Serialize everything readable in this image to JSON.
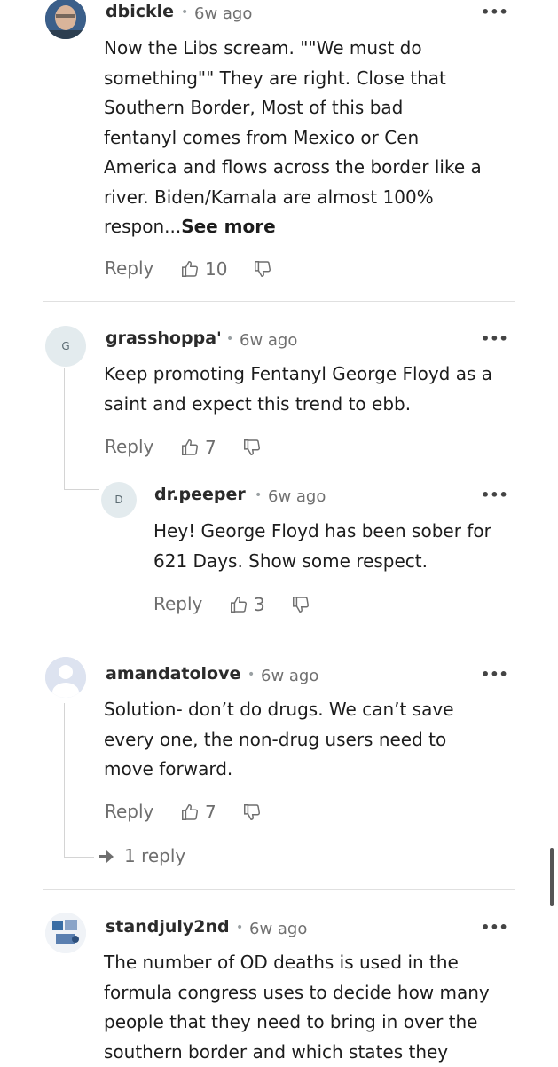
{
  "comments": [
    {
      "username": "dbickle",
      "time": "6w ago",
      "lines": [
        "Now the Libs scream.   \"\"We must do",
        "something\"\"   They are right.  Close that",
        "Southern Border,   Most of this bad",
        "fentanyl  comes from Mexico or Cen",
        "America  and flows across the border like a",
        "river.  Biden/Kamala  are almost  100%",
        "respon..."
      ],
      "see_more": "See more",
      "reply_label": "Reply",
      "likes": "10"
    },
    {
      "username": "grasshoppa'",
      "avatar_letter": "G",
      "time": "6w ago",
      "lines": [
        "Keep promoting Fentanyl George Floyd as a",
        "saint and expect this trend to ebb."
      ],
      "reply_label": "Reply",
      "likes": "7"
    },
    {
      "username": "dr.peeper",
      "avatar_letter": "D",
      "time": "6w ago",
      "lines": [
        "Hey!  George Floyd has been sober for",
        "621 Days.  Show some respect."
      ],
      "reply_label": "Reply",
      "likes": "3"
    },
    {
      "username": "amandatolove",
      "time": "6w ago",
      "lines": [
        "Solution- don’t do drugs. We can’t save",
        "every one, the non-drug users need to",
        "move forward."
      ],
      "reply_label": "Reply",
      "likes": "7",
      "replies": "1 reply"
    },
    {
      "username": "standjuly2nd",
      "time": "6w ago",
      "lines": [
        "The number of OD deaths is used in the",
        "formula congress uses to decide how many",
        "people that they need to bring in over the",
        "southern border and which states they"
      ]
    }
  ],
  "more_symbol": "•••",
  "dot_symbol": "•"
}
